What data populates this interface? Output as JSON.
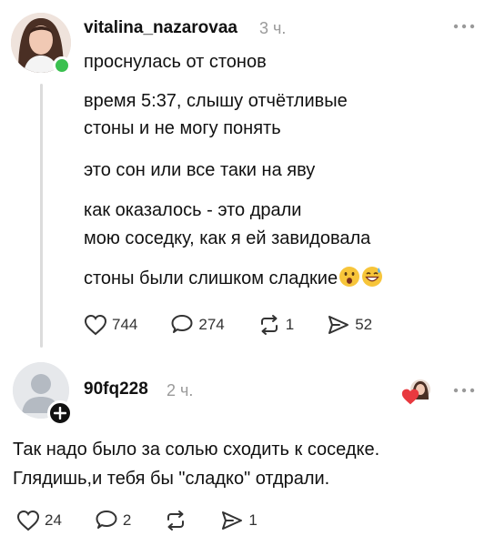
{
  "main_post": {
    "username": "vitalina_nazarovaa",
    "time": "3 ч.",
    "paragraphs": [
      [
        "проснулась от стонов"
      ],
      [
        "время 5:37, слышу отчётливые",
        "стоны и не могу понять"
      ],
      [
        "это сон или все таки на яву"
      ],
      [
        "как оказалось - это драли",
        "мою соседку, как я ей завидовала"
      ],
      [
        "стоны были слишком сладкие"
      ]
    ],
    "emojis": [
      "anguished-face-emoji",
      "grinning-sweat-emoji"
    ],
    "stats": {
      "likes": "744",
      "comments": "274",
      "reposts": "1",
      "shares": "52"
    }
  },
  "reply_post": {
    "username": "90fq228",
    "time": "2 ч.",
    "text_lines": [
      "Так надо было за солью сходить к соседке.",
      "Глядишь,и тебя бы \"сладко\" отдрали."
    ],
    "stats": {
      "likes": "24",
      "comments": "2",
      "reposts": "",
      "shares": "1"
    }
  },
  "colors": {
    "online": "#3ac04f",
    "like_heart": "#e8393f",
    "muted": "#9a9a9a",
    "divider": "#dcdcdc"
  }
}
